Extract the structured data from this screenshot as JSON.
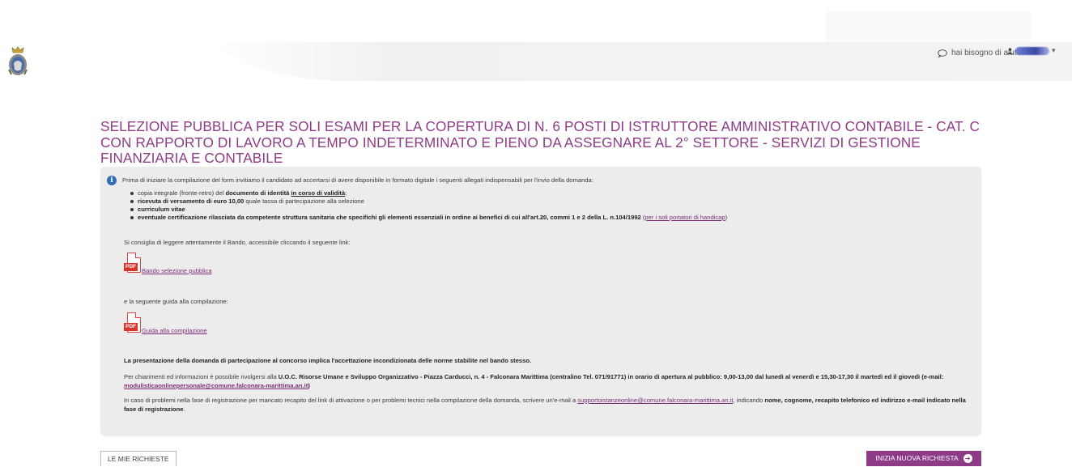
{
  "header": {
    "help_label": "hai bisogno di aiuto?",
    "crest_icon": "municipal-crest-icon",
    "user_icon": "user-icon"
  },
  "title": "SELEZIONE PUBBLICA PER SOLI ESAMI PER LA COPERTURA DI N. 6 POSTI DI ISTRUTTORE AMMINISTRATIVO CONTABILE - CAT. C CON RAPPORTO DI LAVORO A TEMPO INDETERMINATO E PIENO DA ASSEGNARE AL 2° SETTORE - SERVIZI DI GESTIONE FINANZIARIA E CONTABILE",
  "info": {
    "intro": "Prima di iniziare la compilazione del form invitiamo il candidato ad accertarsi di avere disponibile in formato digitale i seguenti allegati indispensabili per l'invio della domanda:",
    "items": [
      {
        "pre": "copia integrale (fronte-retro) del ",
        "bold": "documento di identità",
        "mid": " ",
        "underline": "in corso di validità",
        "post": ";"
      },
      {
        "pre": "ricevuta di versamento di euro 10,00",
        "post": " quale tassa di partecipazione alla selezione"
      },
      {
        "bold": "curriculum vitae"
      },
      {
        "bold": "eventuale certificazione rilasciata da competente struttura sanitaria che specifichi gli elementi essenziali in ordine ai benefici di cui all'art.20, commi 1 e 2 della L. n.104/1992",
        "link": "per i soli portatori di handicap"
      }
    ],
    "advice": "Si consiglia di leggere attentamente il Bando, accessibile cliccando il seguente link:",
    "pdf_label": "PDF",
    "bando_link": "Bando selezione pubblica",
    "guide_text": "e la seguente guida alla compilazione:",
    "guide_link": "Guida alla compilazione",
    "notice": "La presentazione della domanda di partecipazione al concorso implica l'accettazione incondizionata delle norme stabilite nel bando stesso.",
    "contact_pre": "Per chiarimenti ed informazioni è possibile rivolgersi alla ",
    "contact_bold": "U.O.C. Risorse Umane e Sviluppo Organizzativo - Piazza Carducci, n. 4 - Falconara Marittima (centralino Tel. 071/91771) in orario di apertura al pubblico: 9,00-13,00 dal lunedì al venerdì e 15,30-17,30 il martedì ed il giovedì (e-mail: ",
    "contact_email": "modulisticaonlinepersonale@comune.falconara-marittima.an.it",
    "contact_post": ")",
    "problems_pre": "In caso di problemi nella fase di registrazione per mancato recapito del link di attivazione o per problemi tecnici nella compilazione della domanda, scrivere un'e-mail a ",
    "problems_email": "supportoistanzeonline@comune.falconara-marittima.an.it",
    "problems_mid": ", indicando ",
    "problems_bold": "nome, cognome, recapito telefonico ed indirizzo e-mail indicato nella fase di registrazione",
    "problems_post": "."
  },
  "buttons": {
    "my_requests": "LE MIE RICHIESTE",
    "new_request": "INIZIA NUOVA RICHIESTA"
  },
  "colors": {
    "accent": "#8d3b86",
    "info_icon": "#2f6db8",
    "pdf_red": "#d9352b",
    "panel_bg": "#ececec"
  }
}
